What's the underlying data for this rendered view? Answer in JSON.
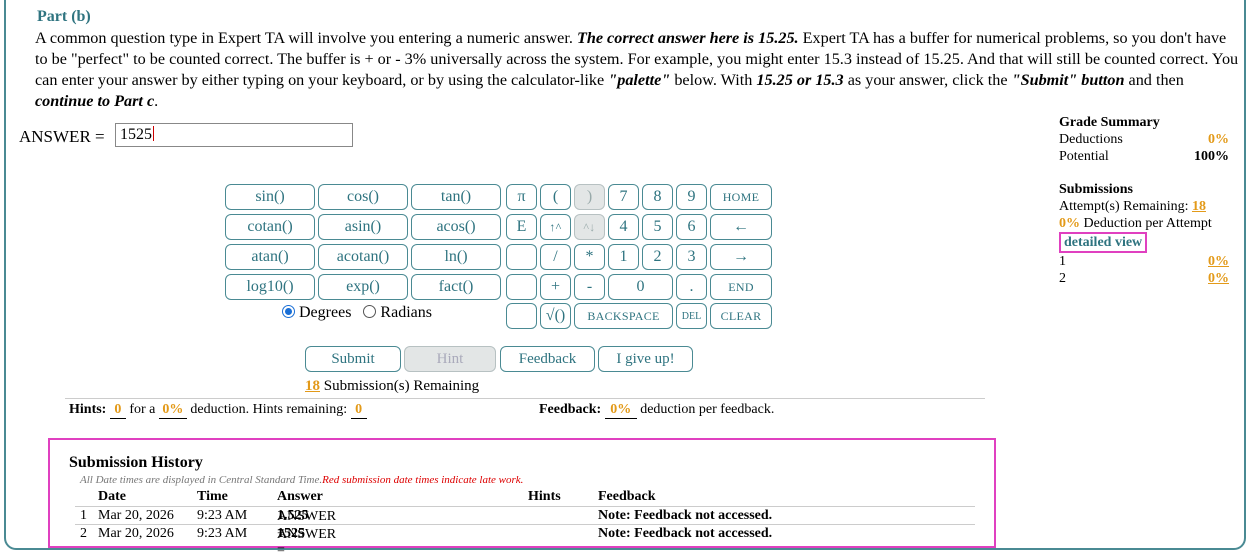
{
  "part": {
    "title": "Part (b)",
    "instructions": [
      {
        "t": "A common question type in Expert TA will involve you entering a numeric answer. ",
        "s": ""
      },
      {
        "t": "The correct answer here is 15.25.",
        "s": "bi"
      },
      {
        "t": " Expert TA has a buffer for numerical problems, so you don't have to be \"perfect\" to be counted correct. The buffer is + or - 3% universally across the system. For example, you might enter 15.3 instead of 15.25. And that will still be counted correct. You can enter your answer by either typing on your keyboard, or by using the calculator-like ",
        "s": ""
      },
      {
        "t": "\"palette\"",
        "s": "bi"
      },
      {
        "t": " below. With ",
        "s": ""
      },
      {
        "t": "15.25 or 15.3",
        "s": "bi"
      },
      {
        "t": " as your answer, click the ",
        "s": ""
      },
      {
        "t": "\"Submit\" button",
        "s": "bi"
      },
      {
        "t": " and then ",
        "s": ""
      },
      {
        "t": "continue to Part c",
        "s": "bi"
      },
      {
        "t": ".",
        "s": ""
      }
    ]
  },
  "answer": {
    "label": "ANSWER =",
    "value": "1525"
  },
  "palette": {
    "functions": [
      "sin()",
      "cos()",
      "tan()",
      "cotan()",
      "asin()",
      "acos()",
      "atan()",
      "acotan()",
      "ln()",
      "log10()",
      "exp()",
      "fact()"
    ],
    "symbols": [
      "π",
      "(",
      ")",
      "E",
      "↑^",
      "^↓",
      "",
      "/",
      "*",
      "",
      "+",
      "-",
      "",
      "√()"
    ],
    "digits": [
      "7",
      "8",
      "9",
      "4",
      "5",
      "6",
      "1",
      "2",
      "3",
      "0",
      "."
    ],
    "nav": [
      "HOME",
      "←",
      "→",
      "END",
      "BACKSPACE",
      "DEL",
      "CLEAR"
    ],
    "angle": {
      "degrees": "Degrees",
      "radians": "Radians",
      "selected": "degrees"
    }
  },
  "actions": {
    "submit": "Submit",
    "hint": "Hint",
    "feedback": "Feedback",
    "give_up": "I give up!"
  },
  "remaining": {
    "count": "18",
    "text": "Submission(s) Remaining"
  },
  "hints": {
    "label": "Hints:",
    "count": "0",
    "for_a": "for a",
    "pct": "0%",
    "text": "deduction. Hints remaining:",
    "remaining": "0"
  },
  "feedback": {
    "label": "Feedback:",
    "pct": "0%",
    "text": "deduction per feedback."
  },
  "grade_summary": {
    "title": "Grade Summary",
    "deductions_label": "Deductions",
    "deductions_value": "0%",
    "potential_label": "Potential",
    "potential_value": "100%",
    "submissions_title": "Submissions",
    "attempts_label": "Attempt(s) Remaining:",
    "attempts_value": "18",
    "deduction_pct": "0%",
    "deduction_text": "Deduction per Attempt",
    "detailed_view": "detailed view",
    "attempts": [
      {
        "n": "1",
        "pct": "0%"
      },
      {
        "n": "2",
        "pct": "0%"
      }
    ]
  },
  "history": {
    "title": "Submission History",
    "note": "All Date times are displayed in Central Standard Time.",
    "note_red": "Red submission date times indicate late work.",
    "columns": [
      "Date",
      "Time",
      "Answer",
      "Hints",
      "Feedback"
    ],
    "rows": [
      {
        "n": "1",
        "date": "Mar 20, 2026",
        "time": "9:23 AM",
        "answer_prefix": "ANSWER = ",
        "answer": "1.525",
        "hints": "",
        "feedback": "Note: Feedback not accessed."
      },
      {
        "n": "2",
        "date": "Mar 20, 2026",
        "time": "9:23 AM",
        "answer_prefix": "ANSWER = ",
        "answer": "1525",
        "hints": "",
        "feedback": "Note: Feedback not accessed."
      }
    ]
  }
}
